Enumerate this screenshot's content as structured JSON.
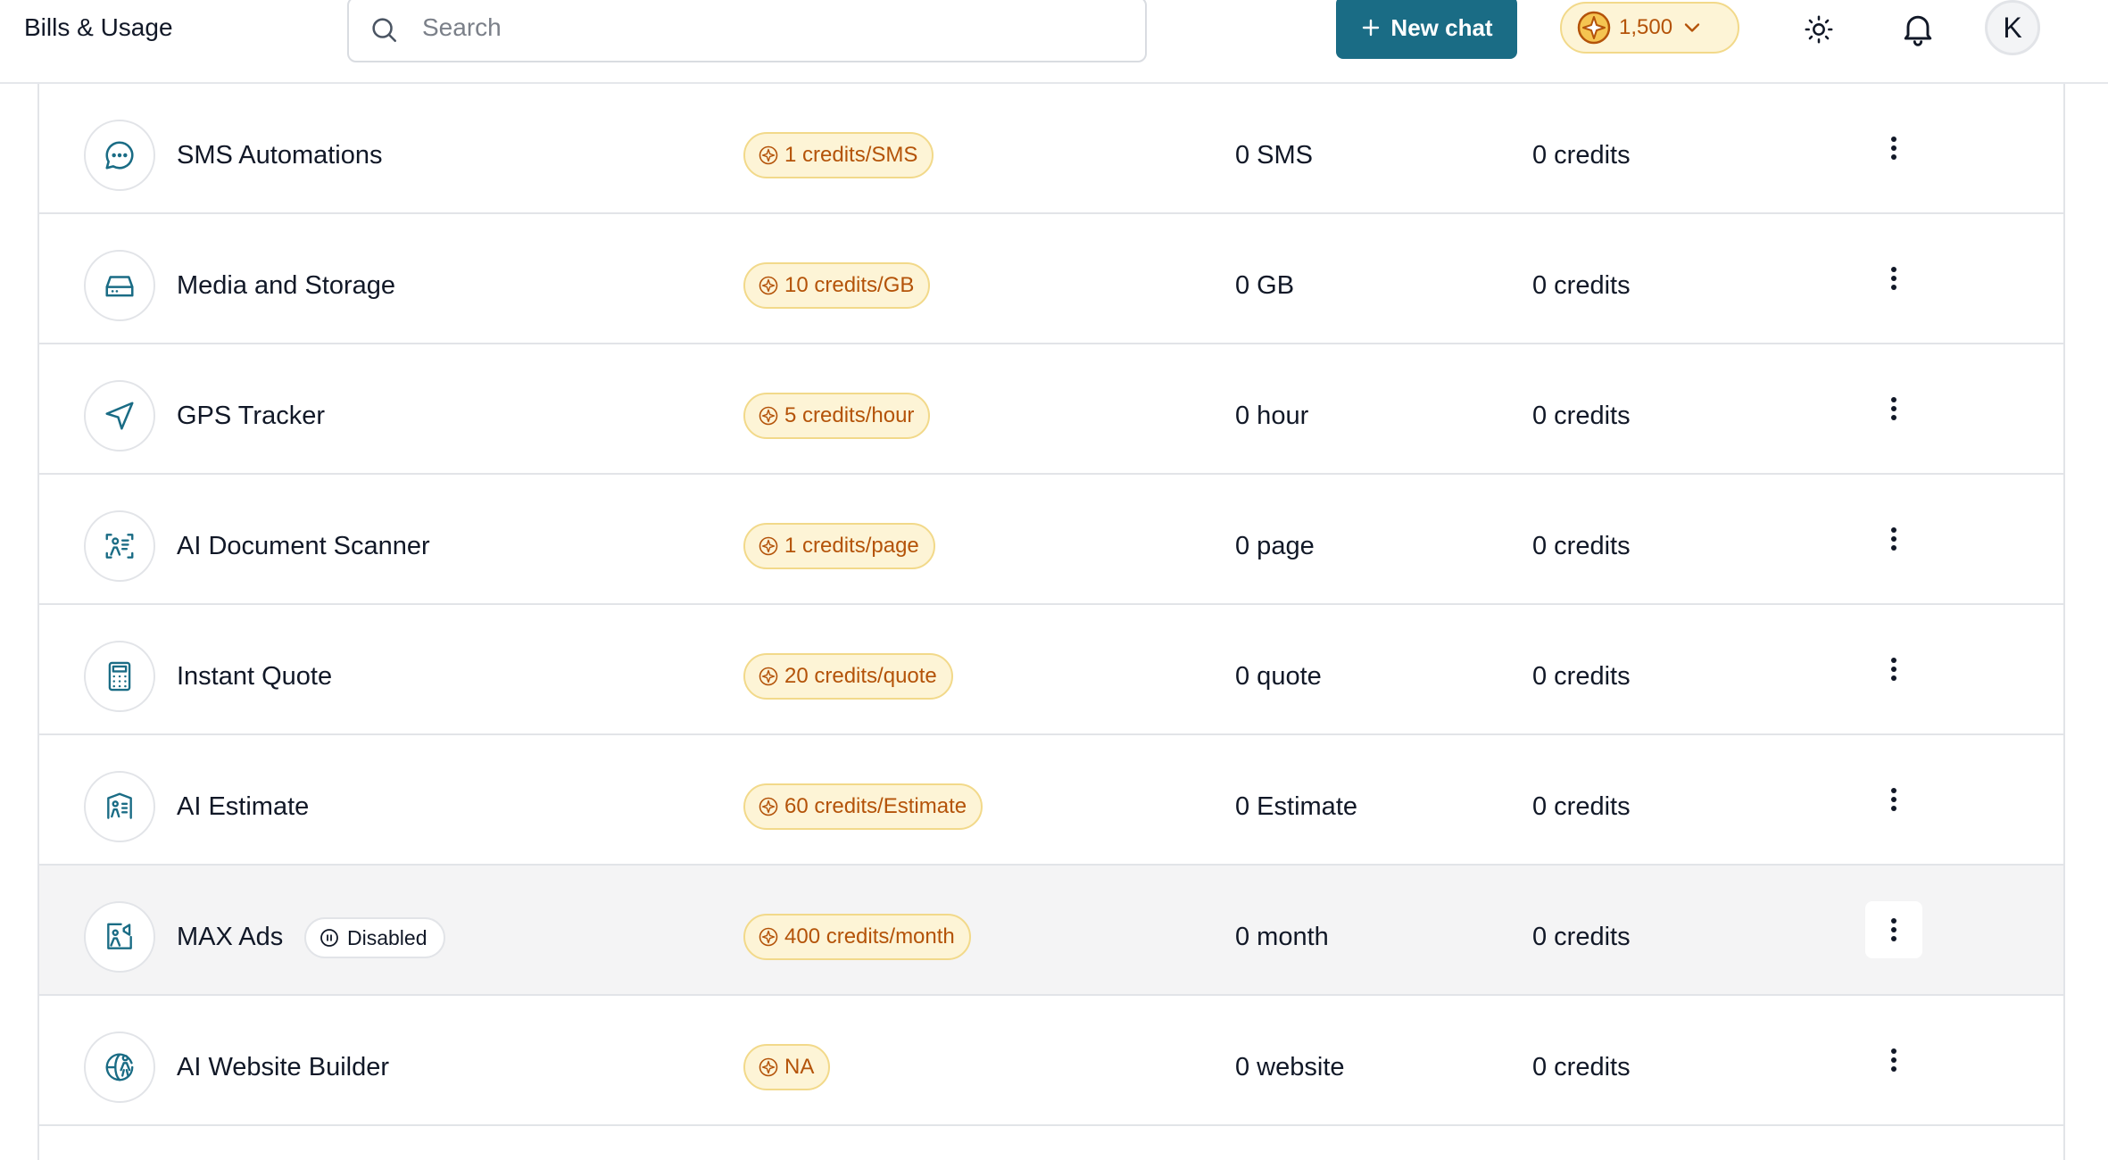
{
  "header": {
    "title": "Bills & Usage",
    "search_placeholder": "Search",
    "new_chat_label": "New chat",
    "credits_balance": "1,500",
    "avatar_initial": "K"
  },
  "colors": {
    "accent": "#1a6c85",
    "credit_text": "#b45309",
    "credit_bg": "#fdf4d6",
    "credit_border": "#f2d98a"
  },
  "services": [
    {
      "name": "SMS Automations",
      "icon": "chat-bubble-icon",
      "rate": "1 credits/SMS",
      "usage": "0 SMS",
      "cost": "0 credits"
    },
    {
      "name": "Media and Storage",
      "icon": "hard-drive-icon",
      "rate": "10 credits/GB",
      "usage": "0 GB",
      "cost": "0 credits"
    },
    {
      "name": "GPS Tracker",
      "icon": "navigation-arrow-icon",
      "rate": "5 credits/hour",
      "usage": "0 hour",
      "cost": "0 credits"
    },
    {
      "name": "AI Document Scanner",
      "icon": "document-scan-icon",
      "rate": "1 credits/page",
      "usage": "0 page",
      "cost": "0 credits"
    },
    {
      "name": "Instant Quote",
      "icon": "calculator-icon",
      "rate": "20 credits/quote",
      "usage": "0 quote",
      "cost": "0 credits"
    },
    {
      "name": "AI Estimate",
      "icon": "estimate-icon",
      "rate": "60 credits/Estimate",
      "usage": "0 Estimate",
      "cost": "0 credits"
    },
    {
      "name": "MAX Ads",
      "icon": "ads-icon",
      "status": "Disabled",
      "rate": "400 credits/month",
      "usage": "0 month",
      "cost": "0 credits"
    },
    {
      "name": "AI Website Builder",
      "icon": "globe-icon",
      "rate": "NA",
      "usage": "0 website",
      "cost": "0 credits"
    }
  ]
}
